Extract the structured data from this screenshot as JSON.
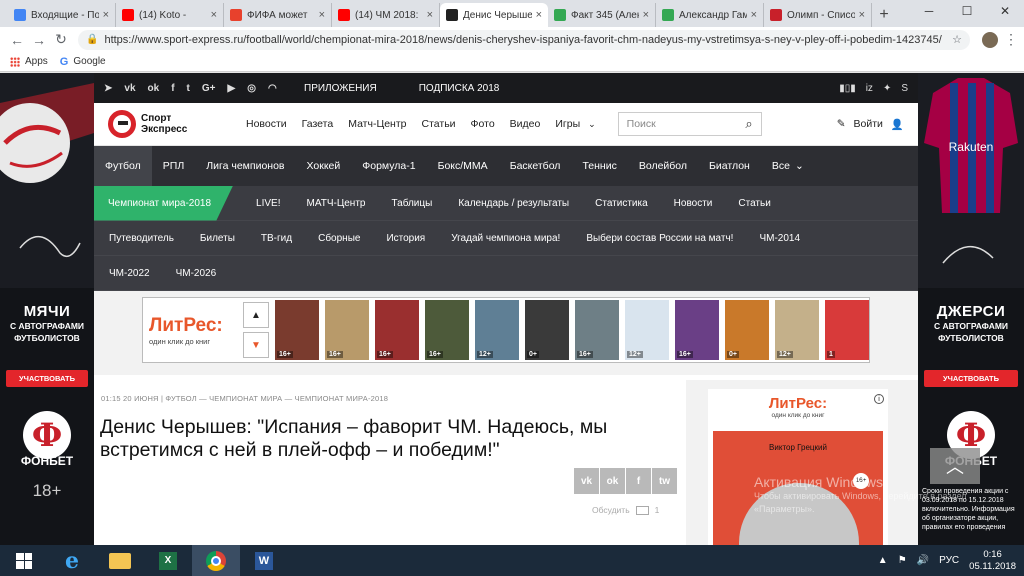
{
  "browser": {
    "tabs": [
      {
        "label": "Входящие - По",
        "color": "#4285f4",
        "active": false
      },
      {
        "label": "(14) Koto - ",
        "color": "#ff0000",
        "active": false
      },
      {
        "label": "ФИФА может",
        "color": "#e8412c",
        "active": false
      },
      {
        "label": "(14) ЧМ 2018:",
        "color": "#ff0000",
        "active": false
      },
      {
        "label": "Денис Черышев",
        "color": "#222222",
        "active": true
      },
      {
        "label": "Факт 345 (Алек",
        "color": "#34a853",
        "active": false
      },
      {
        "label": "Александр Гам",
        "color": "#34a853",
        "active": false
      },
      {
        "label": "Олимп - Списо",
        "color": "#c8202a",
        "active": false
      }
    ],
    "url": "https://www.sport-express.ru/football/world/chempionat-mira-2018/news/denis-cheryshev-ispaniya-favorit-chm-nadeyus-my-vstretimsya-s-ney-v-pley-off-i-pobedim-1423745/",
    "bookmarks": [
      "Apps",
      "Google"
    ]
  },
  "site": {
    "top_links": [
      "ПРИЛОЖЕНИЯ",
      "ПОДПИСКА 2018"
    ],
    "logo_line1": "Спорт",
    "logo_line2": "Экспресс",
    "main_nav": [
      "Новости",
      "Газета",
      "Матч-Центр",
      "Статьи",
      "Фото",
      "Видео",
      "Игры"
    ],
    "search_placeholder": "Поиск",
    "login": "Войти",
    "sport_nav": [
      "Футбол",
      "РПЛ",
      "Лига чемпионов",
      "Хоккей",
      "Формула-1",
      "Бокс/ММА",
      "Баскетбол",
      "Теннис",
      "Волейбол",
      "Биатлон",
      "Все"
    ],
    "wc_badge": "Чемпионат мира-2018",
    "sub_nav_row1": [
      "LIVE!",
      "МАТЧ-Центр",
      "Таблицы",
      "Календарь / результаты",
      "Статистика",
      "Новости",
      "Статьи"
    ],
    "sub_nav_row2": [
      "Путеводитель",
      "Билеты",
      "ТВ-гид",
      "Сборные",
      "История",
      "Угадай чемпиона мира!",
      "Выбери состав России на матч!",
      "ЧМ-2014"
    ],
    "sub_nav_row3": [
      "ЧМ-2022",
      "ЧМ-2026"
    ]
  },
  "banner": {
    "brand": "ЛитРес:",
    "slogan": "один клик до книг",
    "books": [
      {
        "rating": "16+",
        "color": "#7a3b2e"
      },
      {
        "rating": "16+",
        "color": "#b89a6a"
      },
      {
        "rating": "16+",
        "color": "#9a2f2f"
      },
      {
        "rating": "16+",
        "color": "#4d5a3a"
      },
      {
        "rating": "12+",
        "color": "#5f7f95"
      },
      {
        "rating": "0+",
        "color": "#3a3a3a"
      },
      {
        "rating": "16+",
        "color": "#6e7f86"
      },
      {
        "rating": "12+",
        "color": "#d9e4ee"
      },
      {
        "rating": "16+",
        "color": "#6a3f86"
      },
      {
        "rating": "0+",
        "color": "#c9792a"
      },
      {
        "rating": "12+",
        "color": "#c4b08a"
      },
      {
        "rating": "1",
        "color": "#d83a3a"
      }
    ]
  },
  "article": {
    "meta": "01:15 20 ИЮНЯ | ФУТБОЛ — ЧЕМПИОНАТ МИРА — ЧЕМПИОНАТ МИРА-2018",
    "headline": "Денис Черышев: \"Испания – фаворит ЧМ. Надеюсь, мы встретимся с ней в плей-офф – и победим!\"",
    "share": [
      "vk",
      "ok",
      "f",
      "tw"
    ],
    "discuss_label": "Обсудить",
    "discuss_count": "1"
  },
  "side_ad": {
    "author": "Виктор Грецкий",
    "age": "16+",
    "brand": "ЛитРес:",
    "slogan": "один клик до книг"
  },
  "left_promo": {
    "title": "МЯЧИ",
    "subtitle": "С АВТОГРАФАМИ ФУТБОЛИСТОВ",
    "cta": "УЧАСТВОВАТЬ",
    "brand": "ФОНБЕТ",
    "age": "18+"
  },
  "right_promo": {
    "title": "ДЖЕРСИ",
    "subtitle": "С АВТОГРАФАМИ ФУТБОЛИСТОВ",
    "cta": "УЧАСТВОВАТЬ",
    "brand": "ФОНБЕТ",
    "terms": "Сроки проведения акции с 03.09.2018 по 15.12.2018 включительно. Информация об организаторе акции, правилах его проведения"
  },
  "windows": {
    "watermark_title": "Активация Windows",
    "watermark_text": "Чтобы активировать Windows, перейдите в раздел «Параметры»."
  },
  "taskbar": {
    "lang": "РУС",
    "time": "0:16",
    "date": "05.11.2018"
  }
}
